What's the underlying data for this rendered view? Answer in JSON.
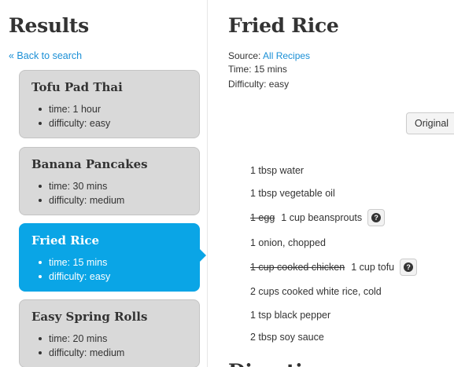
{
  "sidebar": {
    "title": "Results",
    "back_link": "« Back to search",
    "recipes": [
      {
        "name": "Tofu Pad Thai",
        "time": "time: 1 hour",
        "difficulty": "difficulty: easy",
        "selected": false
      },
      {
        "name": "Banana Pancakes",
        "time": "time: 30 mins",
        "difficulty": "difficulty: medium",
        "selected": false
      },
      {
        "name": "Fried Rice",
        "time": "time: 15 mins",
        "difficulty": "difficulty: easy",
        "selected": true
      },
      {
        "name": "Easy Spring Rolls",
        "time": "time: 20 mins",
        "difficulty": "difficulty: medium",
        "selected": false
      }
    ]
  },
  "detail": {
    "title": "Fried Rice",
    "source_label": "Source:",
    "source_link": "All Recipes",
    "time": "Time: 15 mins",
    "difficulty": "Difficulty: easy",
    "original_button": "Original",
    "ingredients": [
      {
        "text": "1 tbsp water"
      },
      {
        "text": "1 tbsp vegetable oil"
      },
      {
        "struck": "1 egg",
        "text": "1 cup beansprouts",
        "help": "?"
      },
      {
        "text": "1 onion, chopped"
      },
      {
        "struck": "1 cup cooked chicken",
        "text": "1 cup tofu",
        "help": "?"
      },
      {
        "text": "2 cups cooked white rice, cold"
      },
      {
        "text": "1 tsp black pepper"
      },
      {
        "text": "2 tbsp soy sauce"
      }
    ],
    "next_heading": "Directions"
  },
  "colors": {
    "selected": "#0aa5e6",
    "card": "#d9d9d9",
    "link": "#1a8fd6"
  }
}
